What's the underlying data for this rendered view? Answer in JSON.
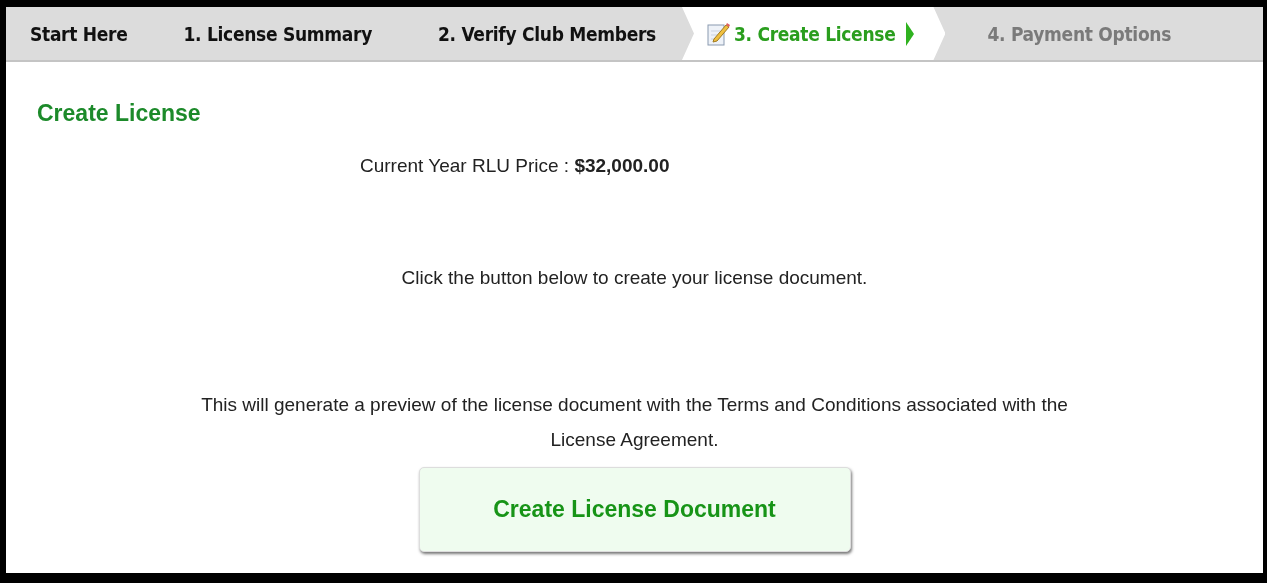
{
  "tabs": [
    {
      "label": "Start Here",
      "selected": false,
      "disabled": false
    },
    {
      "label": "1. License Summary",
      "selected": false,
      "disabled": false
    },
    {
      "label": "2. Verify Club Members",
      "selected": false,
      "disabled": false
    },
    {
      "label": "3. Create License",
      "selected": true,
      "disabled": false
    },
    {
      "label": "4. Payment Options",
      "selected": false,
      "disabled": true
    }
  ],
  "heading": "Create License",
  "price_line": "Current Year RLU Price : **$32,000.00**",
  "instruction": "Click the button below to create your license document.",
  "description": "This will generate a preview of the license document with the Terms and Conditions associated with the License Agreement.",
  "button": "Create License Document"
}
